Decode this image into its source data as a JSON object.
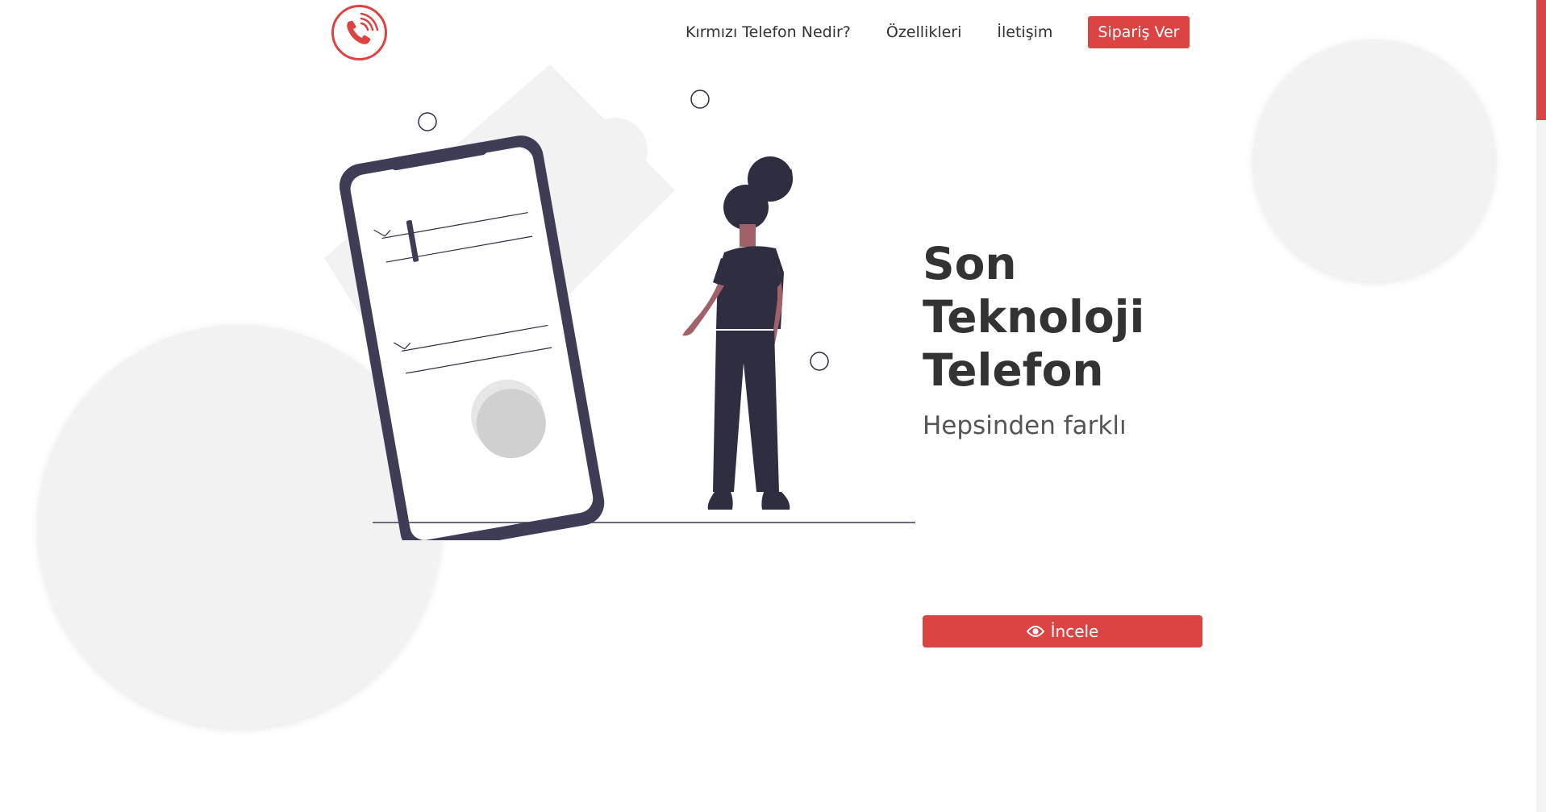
{
  "header": {
    "logo": "phone-call-logo",
    "nav": [
      {
        "label": "Kırmızı Telefon Nedir?"
      },
      {
        "label": "Özellikleri"
      },
      {
        "label": "İletişim"
      }
    ],
    "order_label": "Sipariş Ver"
  },
  "hero": {
    "title": "Son Teknoloji Telefon",
    "subtitle": "Hepsinden farklı",
    "button_label": "İncele",
    "button_icon": "eye-icon"
  },
  "colors": {
    "accent": "#dc4444",
    "text": "#333333",
    "illustration_dark": "#2f2e41",
    "background_circle": "#f2f2f2"
  }
}
